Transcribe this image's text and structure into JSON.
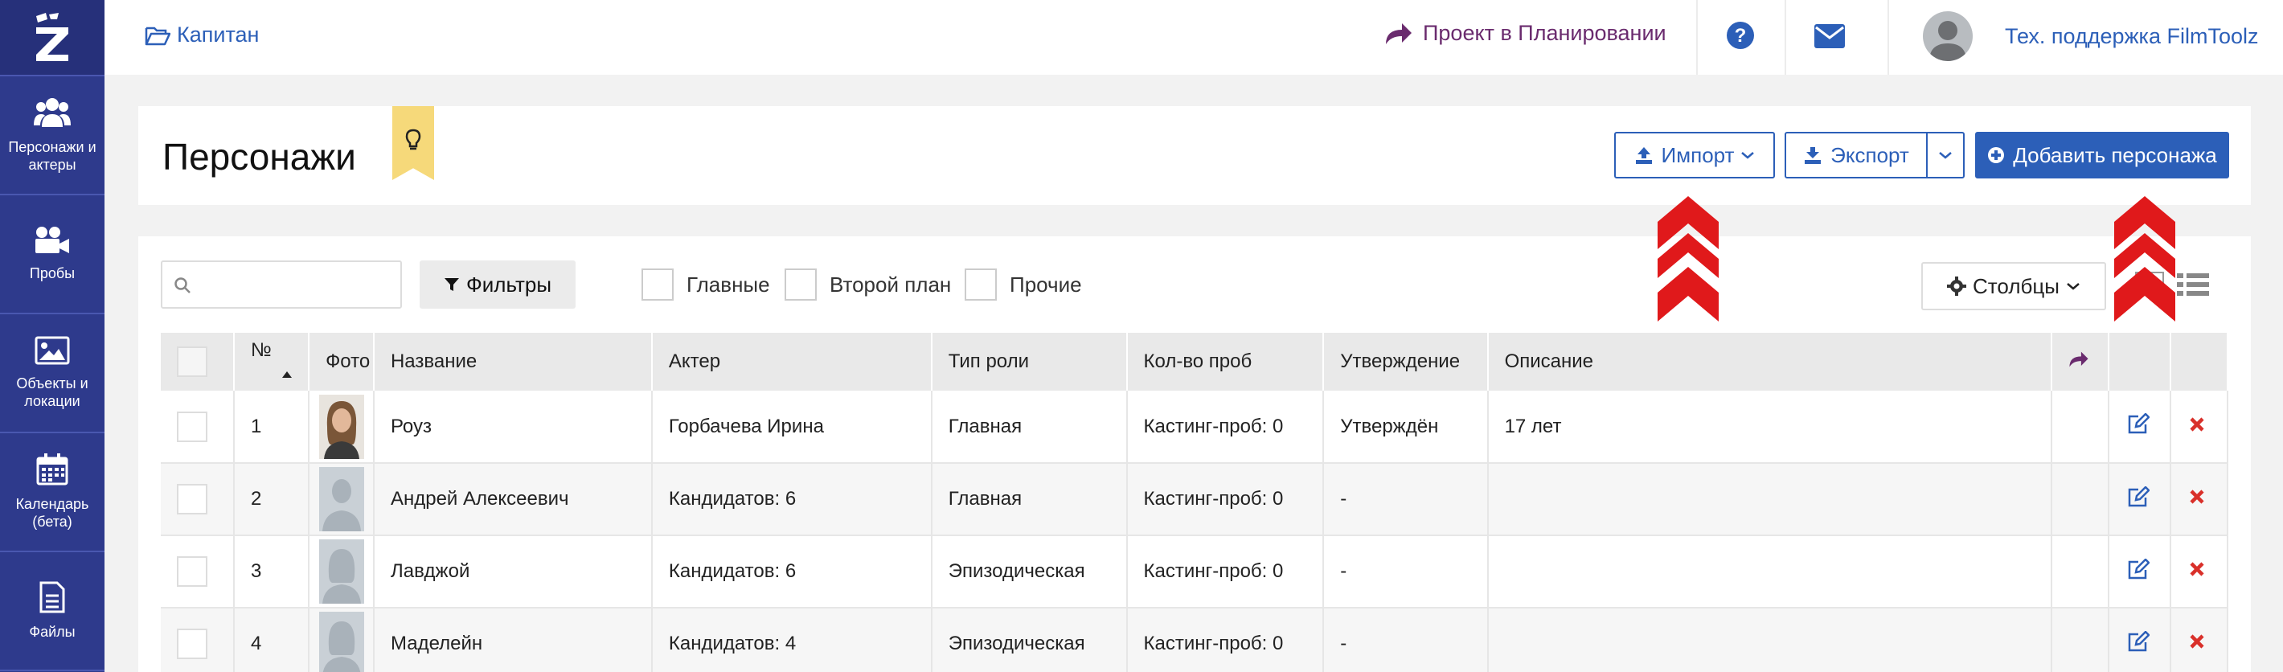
{
  "sidebar": {
    "logo": "Z",
    "items": [
      {
        "label": "Персонажи и актеры"
      },
      {
        "label": "Пробы"
      },
      {
        "label": "Объекты и локации"
      },
      {
        "label": "Календарь (бета)"
      },
      {
        "label": "Файлы"
      }
    ]
  },
  "topbar": {
    "breadcrumb": "Капитан",
    "project_status": "Проект в Планировании",
    "user_name": "Тех. поддержка FilmToolz"
  },
  "header": {
    "title": "Персонажи",
    "import_label": "Импорт",
    "export_label": "Экспорт",
    "add_label": "Добавить персонажа"
  },
  "toolbar": {
    "search_placeholder": "",
    "filters_label": "Фильтры",
    "filter_main": "Главные",
    "filter_secondary": "Второй план",
    "filter_other": "Прочие",
    "columns_label": "Столбцы"
  },
  "table": {
    "headers": {
      "num": "№",
      "photo": "Фото",
      "name": "Название",
      "actor": "Актер",
      "role_type": "Тип роли",
      "tests": "Кол-во проб",
      "approval": "Утверждение",
      "description": "Описание"
    },
    "rows": [
      {
        "num": "1",
        "name": "Роуз",
        "actor": "Горбачева Ирина",
        "role_type": "Главная",
        "tests": "Кастинг-проб: 0",
        "approval": "Утверждён",
        "description": "17 лет"
      },
      {
        "num": "2",
        "name": "Андрей Алексеевич",
        "actor": "Кандидатов: 6",
        "role_type": "Главная",
        "tests": "Кастинг-проб: 0",
        "approval": "-",
        "description": ""
      },
      {
        "num": "3",
        "name": "Лавджой",
        "actor": "Кандидатов: 6",
        "role_type": "Эпизодическая",
        "tests": "Кастинг-проб: 0",
        "approval": "-",
        "description": ""
      },
      {
        "num": "4",
        "name": "Маделейн",
        "actor": "Кандидатов: 4",
        "role_type": "Эпизодическая",
        "tests": "Кастинг-проб: 0",
        "approval": "-",
        "description": ""
      }
    ]
  },
  "colors": {
    "sidebar": "#2e3a8c",
    "accent": "#2c5fb8",
    "project": "#6a2b6e",
    "delete": "#d9302a",
    "annotation_arrow": "#e0191b"
  }
}
